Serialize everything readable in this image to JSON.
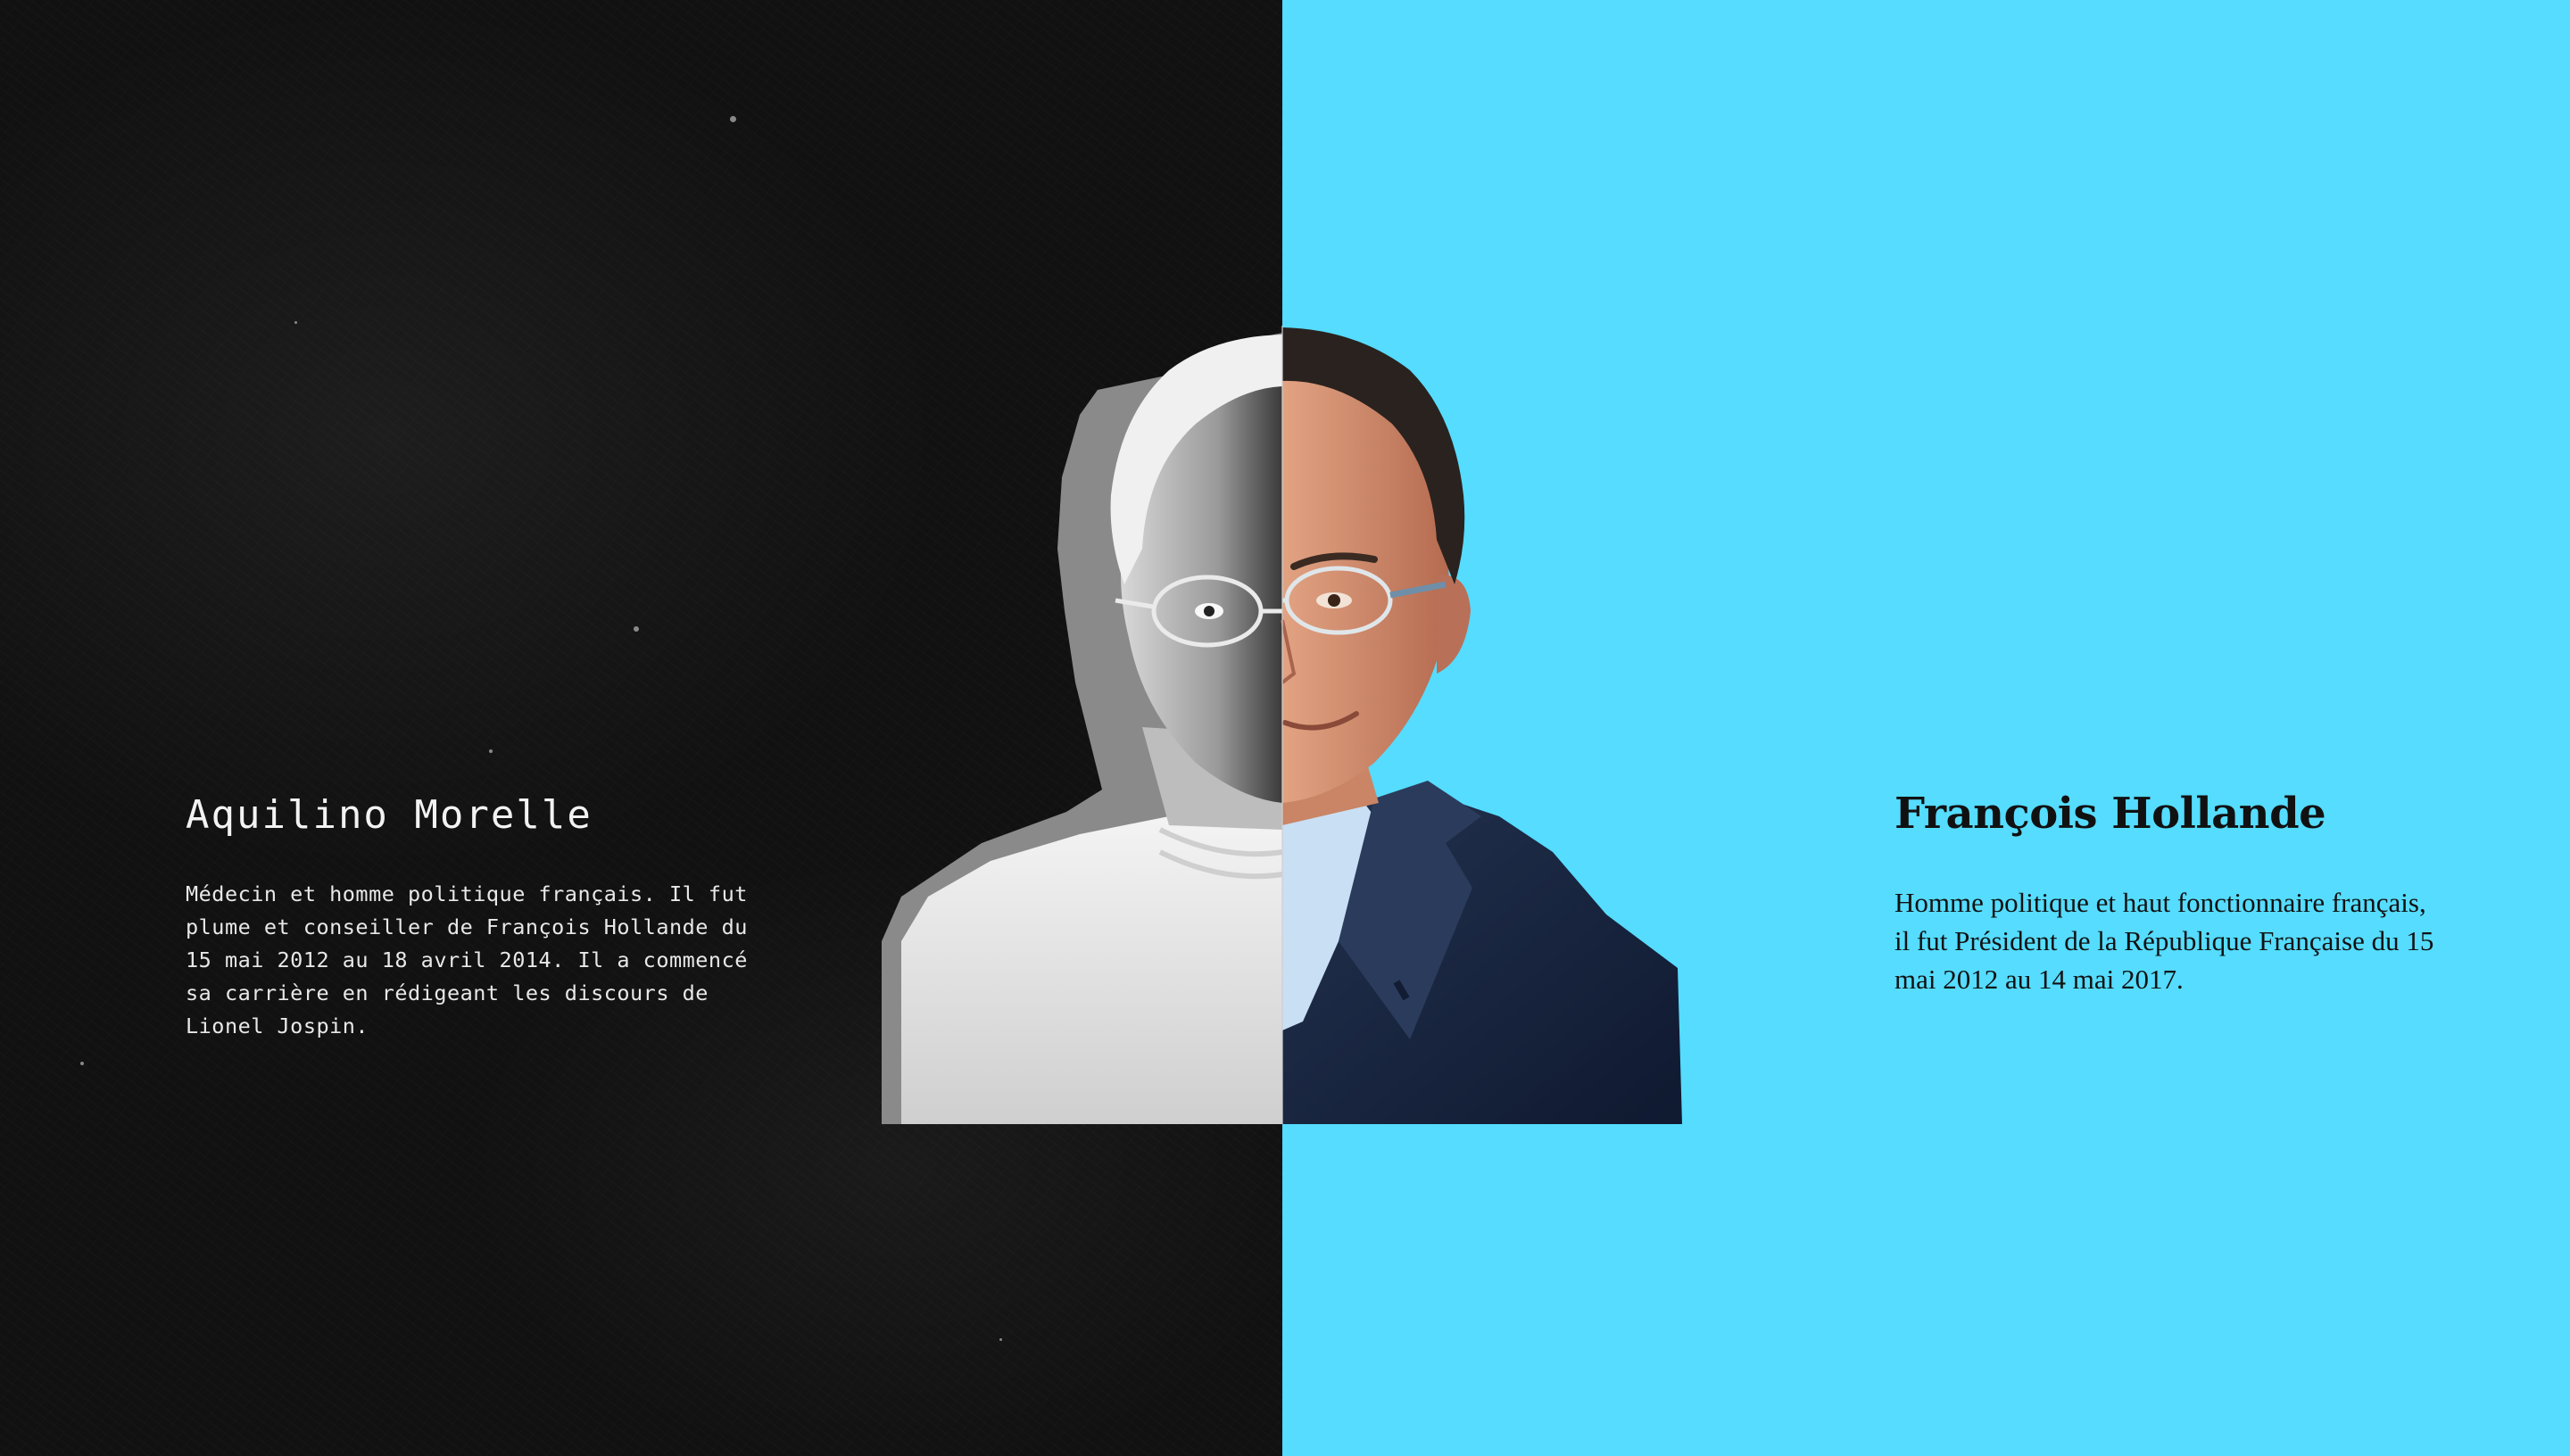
{
  "left_person": {
    "name": "Aquilino Morelle",
    "bio_lines": [
      "Médecin et homme politique français. Il fut",
      "plume et conseiller de François Hollande du",
      "15 mai 2012 au 18 avril 2014. Il a commencé",
      "sa carrière en rédigeant les discours de",
      "Lionel Jospin."
    ]
  },
  "right_person": {
    "name": "François Hollande",
    "bio_lines": [
      "Homme politique et haut fonctionnaire français,",
      "il fut Président de la République Française du 15",
      "mai 2012 au 14 mai 2017."
    ]
  },
  "colors": {
    "left_background": "#111111",
    "right_background": "#55DCFF",
    "left_text": "#F2F2F2",
    "right_text": "#111111"
  },
  "images": {
    "composite_portrait": "split-face-portrait"
  }
}
